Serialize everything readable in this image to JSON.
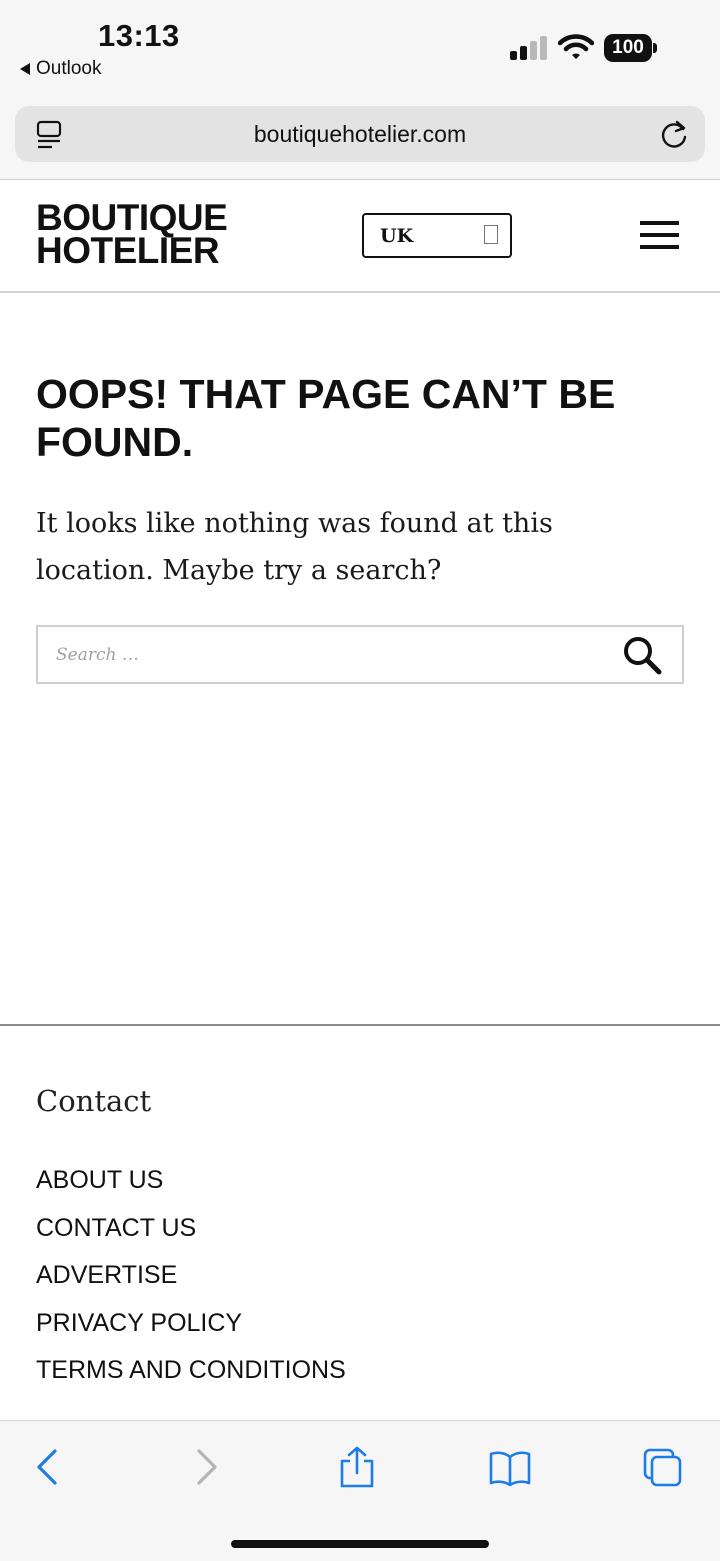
{
  "status_bar": {
    "time": "13:13",
    "back_app": "Outlook",
    "battery": "100"
  },
  "address_bar": {
    "url": "boutiquehotelier.com"
  },
  "header": {
    "logo_line1": "BOUTIQUE",
    "logo_line2": "HOTELIER",
    "region": "UK"
  },
  "main": {
    "title": "OOPS! THAT PAGE CAN’T BE FOUND.",
    "message": "It looks like nothing was found at this location. Maybe try a search?",
    "search_placeholder": "Search …"
  },
  "footer": {
    "heading": "Contact",
    "links": [
      "ABOUT US",
      "CONTACT US",
      "ADVERTISE",
      "PRIVACY POLICY",
      "TERMS AND CONDITIONS"
    ]
  },
  "icons": {
    "accent": "#1e7ce8",
    "disabled": "#b4b4b4"
  }
}
